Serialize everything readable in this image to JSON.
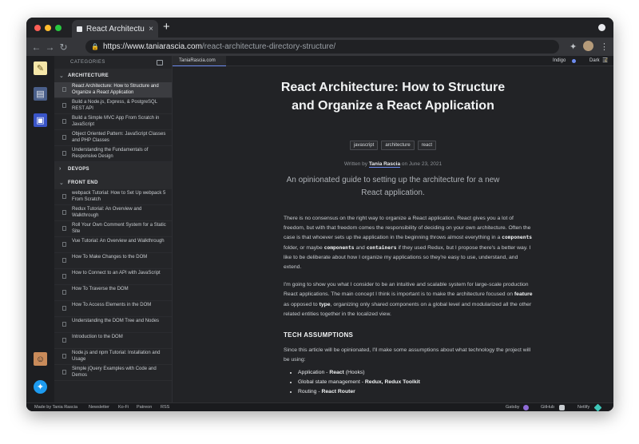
{
  "browser": {
    "tab_title": "React Architecture: How to Structure",
    "tab_close": "×",
    "new_tab": "+",
    "url_domain": "https://www.taniarascia.com",
    "url_path": "/react-architecture-directory-structure/"
  },
  "sidebar": {
    "header": "CATEGORIES",
    "groups": [
      {
        "label": "ARCHITECTURE",
        "chevron": "⌄",
        "items": [
          "React Architecture: How to Structure and Organize a React Application",
          "Build a Node.js, Express, & PostgreSQL REST API",
          "Build a Simple MVC App From Scratch in JavaScript",
          "Object Oriented Pattern: JavaScript Classes and PHP Classes",
          "Understanding the Fundamentals of Responsive Design"
        ]
      },
      {
        "label": "DEVOPS",
        "chevron": "›",
        "items": []
      },
      {
        "label": "FRONT END",
        "chevron": "⌄",
        "items": [
          "webpack Tutorial: How to Set Up webpack 5 From Scratch",
          "Redux Tutorial: An Overview and Walkthrough",
          "Roll Your Own Comment System for a Static Site",
          "Vue Tutorial: An Overview and Walkthrough",
          "How To Make Changes to the DOM",
          "How to Connect to an API with JavaScript",
          "How To Traverse the DOM",
          "How To Access Elements in the DOM",
          "Understanding the DOM Tree and Nodes",
          "Introduction to the DOM",
          "Node.js and npm Tutorial: Installation and Usage",
          "Simple jQuery Examples with Code and Demos"
        ]
      }
    ]
  },
  "topbar": {
    "site_tab": "TaniaRascia.com",
    "theme_color": "Indigo",
    "mode": "Dark",
    "menu": "☰"
  },
  "article": {
    "title_line1": "React Architecture: How to Structure",
    "title_line2": "and Organize a React Application",
    "tags": [
      "javascript",
      "architecture",
      "react"
    ],
    "written_by": "Written by",
    "author": "Tania Rascia",
    "date": "on June 23, 2021",
    "subtitle": "An opinionated guide to setting up the architecture for a new React application.",
    "p1_a": "There is no consensus on the right way to organize a React application. React gives you a lot of freedom, but with that freedom comes the responsibility of deciding on your own architecture. Often the case is that whoever sets up the application in the beginning throws almost everything in a",
    "p1_code1": "components",
    "p1_b": "folder, or maybe",
    "p1_code2": "components",
    "p1_c": "and",
    "p1_code3": "containers",
    "p1_d": "if they used Redux, but I propose there's a better way. I like to be deliberate about how I organize my applications so they're easy to use, understand, and extend.",
    "p2_a": "I'm going to show you what I consider to be an intuitive and scalable system for large-scale production React applications. The main concept I think is important is to make the architecture focused on",
    "p2_b1": "feature",
    "p2_b": "as opposed to",
    "p2_b2": "type",
    "p2_c": ", organizing only shared components on a global level and modularized all the other related entities together in the localized view.",
    "section_heading": "TECH ASSUMPTIONS",
    "p3": "Since this article will be opinionated, I'll make some assumptions about what technology the project will be using:",
    "list": [
      {
        "label": "Application",
        "sep": " - ",
        "value": "React",
        "extra": " (Hooks)"
      },
      {
        "label": "Global state management",
        "sep": " - ",
        "value": "Redux",
        "extra": ", Redux Toolkit"
      },
      {
        "label": "Routing",
        "sep": " - ",
        "value": "React Router",
        "extra": ""
      }
    ]
  },
  "footer": {
    "made_by": "Made by Tania Rascia",
    "links": [
      "Newsletter",
      "Ko-Fi",
      "Patreon",
      "RSS"
    ],
    "gatsby": "Gatsby",
    "github": "GitHub",
    "netlify": "Netlify"
  },
  "colors": {
    "accent": "#6e8cf0",
    "background": "#222326",
    "sidebar": "#242528",
    "moon": "#f2c94c"
  }
}
